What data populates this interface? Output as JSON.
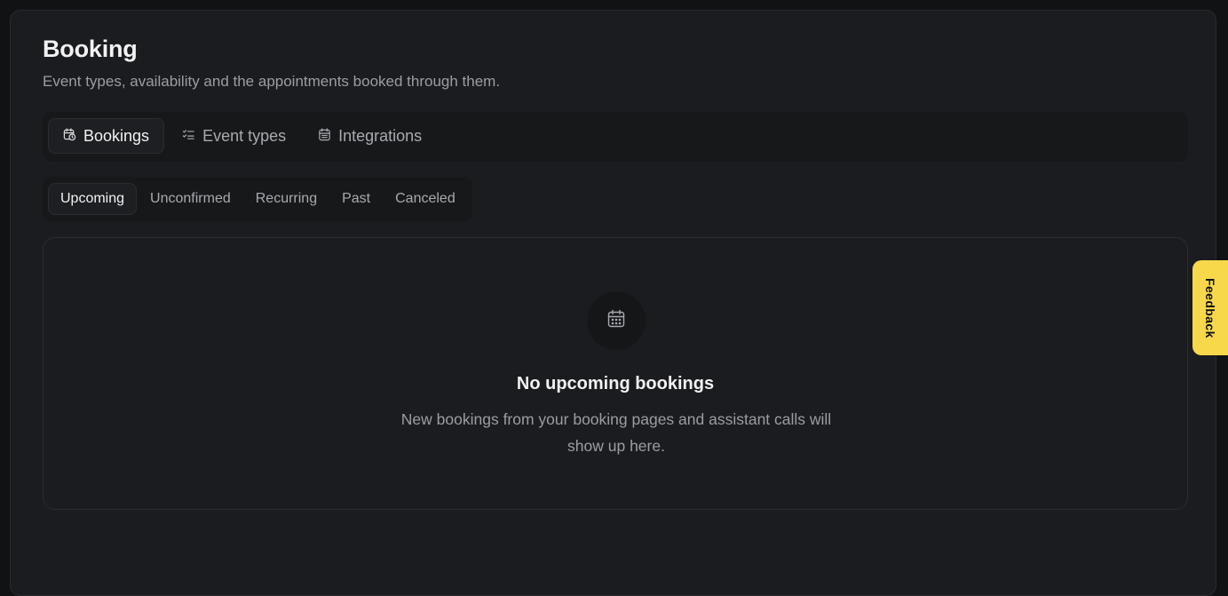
{
  "page": {
    "title": "Booking",
    "subtitle": "Event types, availability and the appointments booked through them."
  },
  "main_tabs": [
    {
      "label": "Bookings",
      "icon": "calendar-clock-icon",
      "active": true
    },
    {
      "label": "Event types",
      "icon": "list-check-icon",
      "active": false
    },
    {
      "label": "Integrations",
      "icon": "calendar-icon",
      "active": false
    }
  ],
  "sub_tabs": [
    {
      "label": "Upcoming",
      "active": true
    },
    {
      "label": "Unconfirmed",
      "active": false
    },
    {
      "label": "Recurring",
      "active": false
    },
    {
      "label": "Past",
      "active": false
    },
    {
      "label": "Canceled",
      "active": false
    }
  ],
  "empty_state": {
    "icon": "calendar-icon",
    "title": "No upcoming bookings",
    "description": "New bookings from your booking pages and assistant calls will show up here."
  },
  "feedback": {
    "label": "Feedback",
    "color": "#f7d84a"
  }
}
